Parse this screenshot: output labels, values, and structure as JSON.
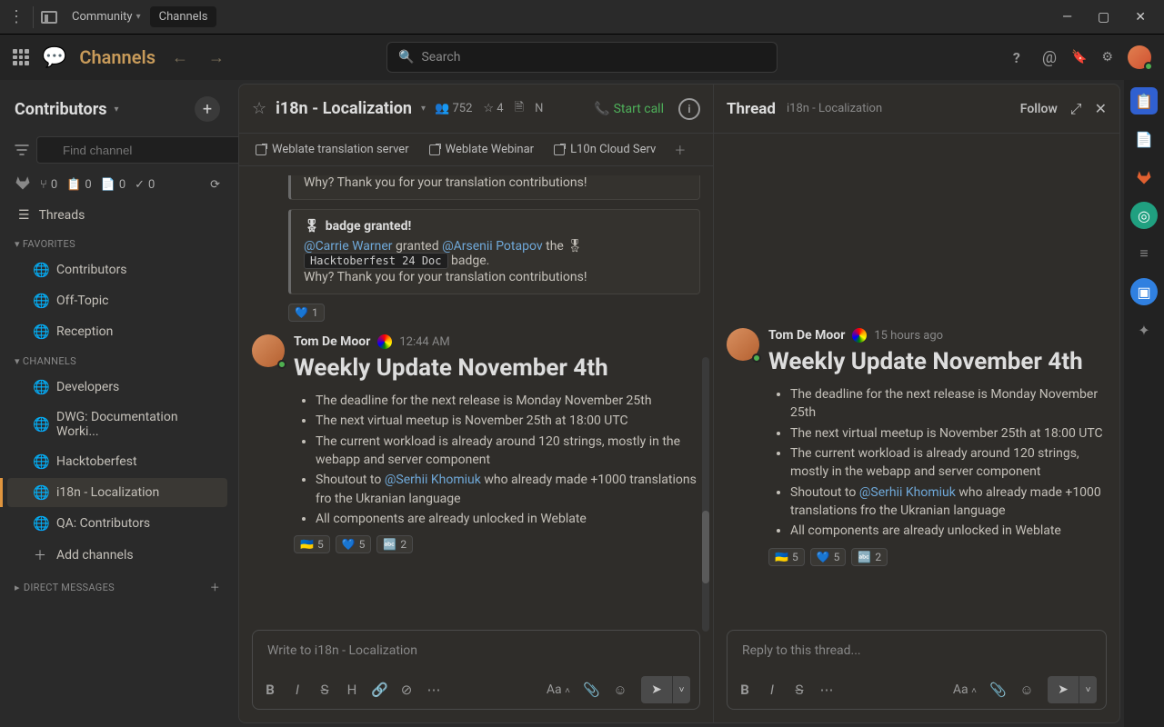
{
  "titlebar": {
    "tab1": "Community",
    "tab2": "Channels"
  },
  "header": {
    "brand": "Channels",
    "search_placeholder": "Search"
  },
  "sidebar": {
    "workspace": "Contributors",
    "find_placeholder": "Find channel",
    "counts": {
      "mr": "0",
      "todo": "0",
      "doc": "0",
      "review": "0"
    },
    "threads": "Threads",
    "sections": {
      "favorites": "FAVORITES",
      "channels": "CHANNELS",
      "direct": "DIRECT MESSAGES"
    },
    "favorites": [
      "Contributors",
      "Off-Topic",
      "Reception"
    ],
    "channels": [
      "Developers",
      "DWG: Documentation Worki...",
      "Hacktoberfest",
      "i18n - Localization",
      "QA: Contributors"
    ],
    "add_channels": "Add channels"
  },
  "channel": {
    "name": "i18n - Localization",
    "members": "752",
    "starred": "4",
    "notes_indicator": "N",
    "call": "Start call",
    "pinned": [
      "Weblate translation server",
      "Weblate Webinar",
      "L10n Cloud Serv"
    ]
  },
  "badge_card": {
    "top_line": "Why? Thank you for your translation contributions!",
    "title": "badge granted!",
    "granter": "@Carrie Warner",
    "granted_word": " granted ",
    "grantee": "@Arsenii Potapov",
    "the_word": " the ",
    "code": "Hacktoberfest 24 Doc",
    "badge_word": " badge.",
    "why": "Why? Thank you for your translation contributions!",
    "react": {
      "emoji": "💙",
      "count": "1"
    }
  },
  "post": {
    "author": "Tom De Moor",
    "time": "12:44 AM",
    "title": "Weekly Update November 4th",
    "items": [
      "The deadline for the next release is Monday November 25th",
      "The next virtual meetup is November 25th at 18:00 UTC",
      "The current workload is already around 120 strings, mostly in the webapp and server component",
      "All components are already unlocked in Weblate"
    ],
    "shoutout_pre": "Shoutout to ",
    "shoutout_mention": "@Serhii Khomiuk",
    "shoutout_post": " who already made +1000 translations fro the Ukranian language",
    "reactions": [
      {
        "emoji": "🇺🇦",
        "count": "5"
      },
      {
        "emoji": "💙",
        "count": "5"
      },
      {
        "emoji": "🔤",
        "count": "2"
      }
    ]
  },
  "composer": {
    "placeholder": "Write to i18n - Localization",
    "aa": "Aa"
  },
  "thread": {
    "title": "Thread",
    "sub": "i18n - Localization",
    "follow": "Follow",
    "time": "15 hours ago",
    "composer_placeholder": "Reply to this thread...",
    "aa": "Aa"
  }
}
